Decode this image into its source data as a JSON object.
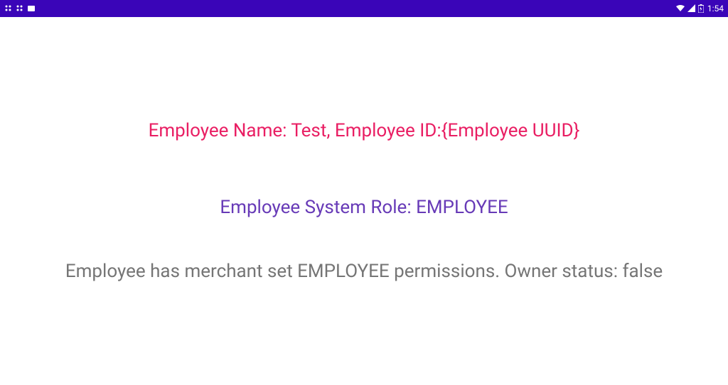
{
  "status_bar": {
    "time": "1:54"
  },
  "content": {
    "line1": "Employee Name: Test, Employee ID:{Employee UUID}",
    "line2": "Employee System Role: EMPLOYEE",
    "line3": "Employee has merchant set EMPLOYEE permissions. Owner status: false"
  }
}
